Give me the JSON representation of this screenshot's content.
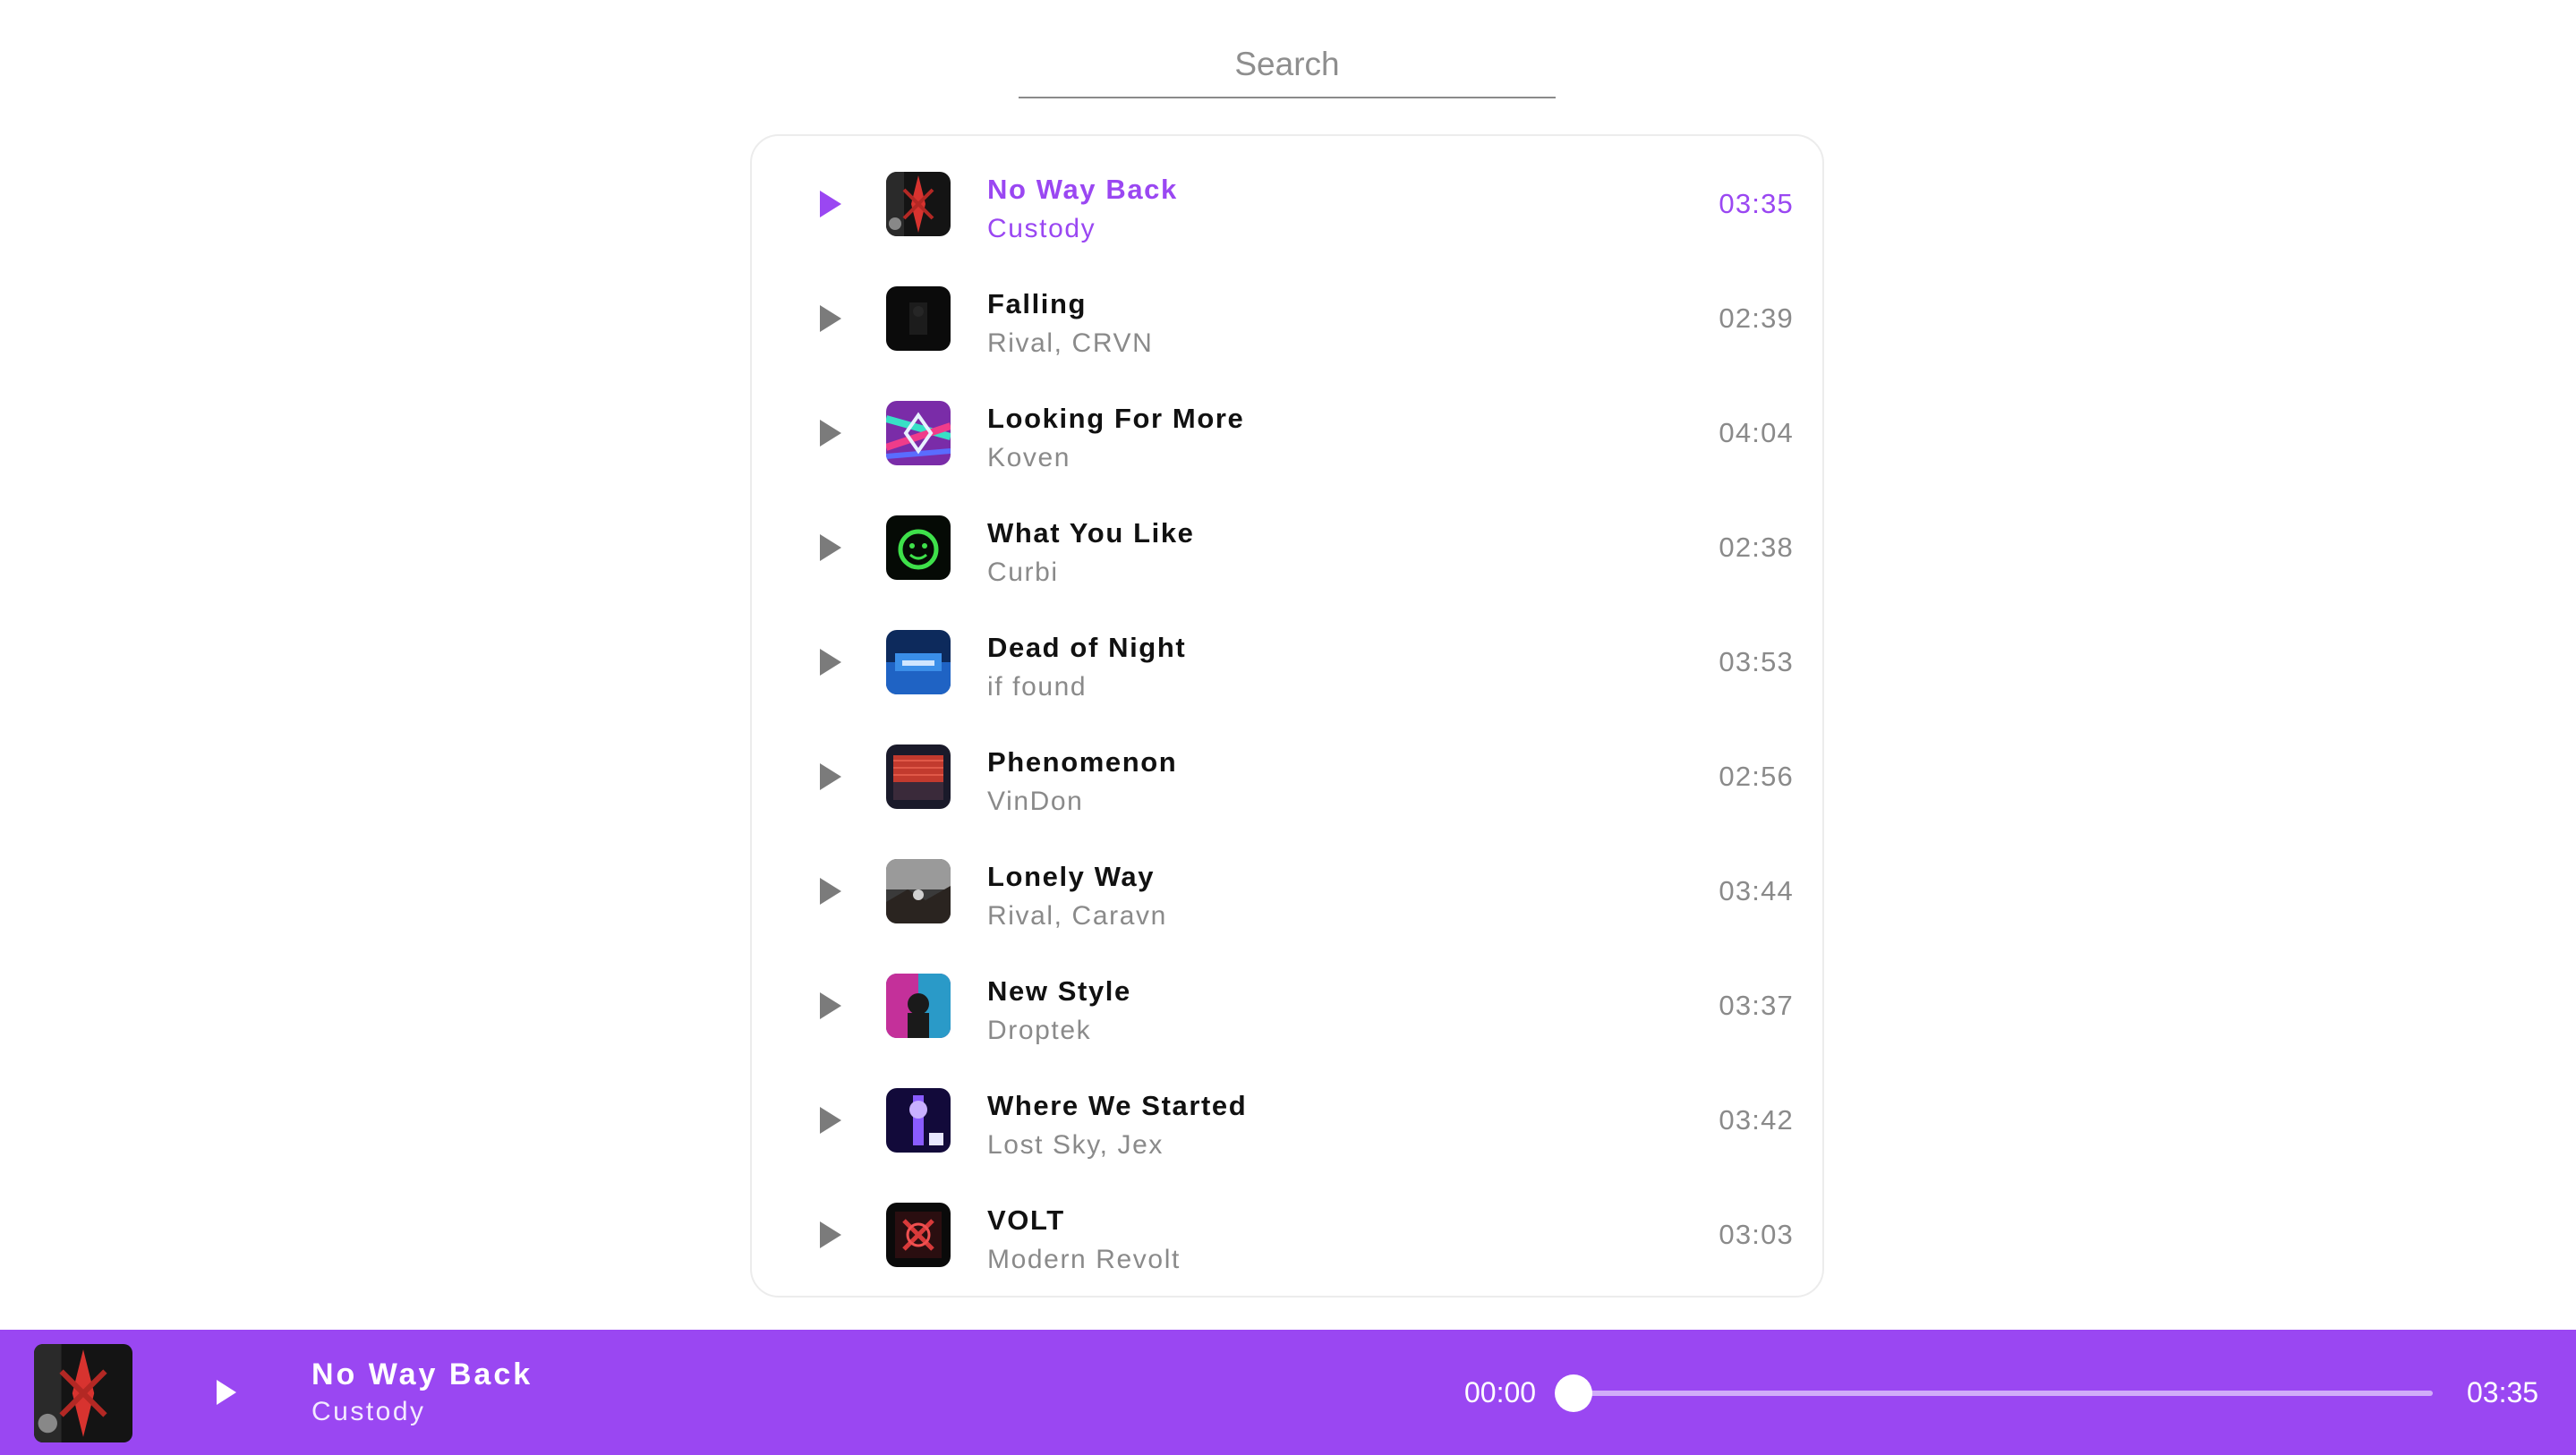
{
  "search": {
    "placeholder": "Search"
  },
  "tracks": [
    {
      "title": "No Way Back",
      "artist": "Custody",
      "duration": "03:35",
      "active": true,
      "cover_icon": "cover-art-no-way-back"
    },
    {
      "title": "Falling",
      "artist": "Rival, CRVN",
      "duration": "02:39",
      "active": false,
      "cover_icon": "cover-art-falling"
    },
    {
      "title": "Looking For More",
      "artist": "Koven",
      "duration": "04:04",
      "active": false,
      "cover_icon": "cover-art-looking-for-more"
    },
    {
      "title": "What You Like",
      "artist": "Curbi",
      "duration": "02:38",
      "active": false,
      "cover_icon": "cover-art-what-you-like"
    },
    {
      "title": "Dead of Night",
      "artist": "if found",
      "duration": "03:53",
      "active": false,
      "cover_icon": "cover-art-dead-of-night"
    },
    {
      "title": "Phenomenon",
      "artist": "VinDon",
      "duration": "02:56",
      "active": false,
      "cover_icon": "cover-art-phenomenon"
    },
    {
      "title": "Lonely Way",
      "artist": "Rival, Caravn",
      "duration": "03:44",
      "active": false,
      "cover_icon": "cover-art-lonely-way"
    },
    {
      "title": "New Style",
      "artist": "Droptek",
      "duration": "03:37",
      "active": false,
      "cover_icon": "cover-art-new-style"
    },
    {
      "title": "Where We Started",
      "artist": "Lost Sky, Jex",
      "duration": "03:42",
      "active": false,
      "cover_icon": "cover-art-where-we-started"
    },
    {
      "title": "VOLT",
      "artist": "Modern Revolt",
      "duration": "03:03",
      "active": false,
      "cover_icon": "cover-art-volt"
    }
  ],
  "player": {
    "title": "No Way Back",
    "artist": "Custody",
    "current_time": "00:00",
    "total_time": "03:35",
    "progress": 0.0,
    "play_icon": "play-icon"
  },
  "colors": {
    "accent": "#9a47f2",
    "text_primary": "#111111",
    "text_secondary": "#8a8a8a",
    "background": "#ffffff"
  }
}
